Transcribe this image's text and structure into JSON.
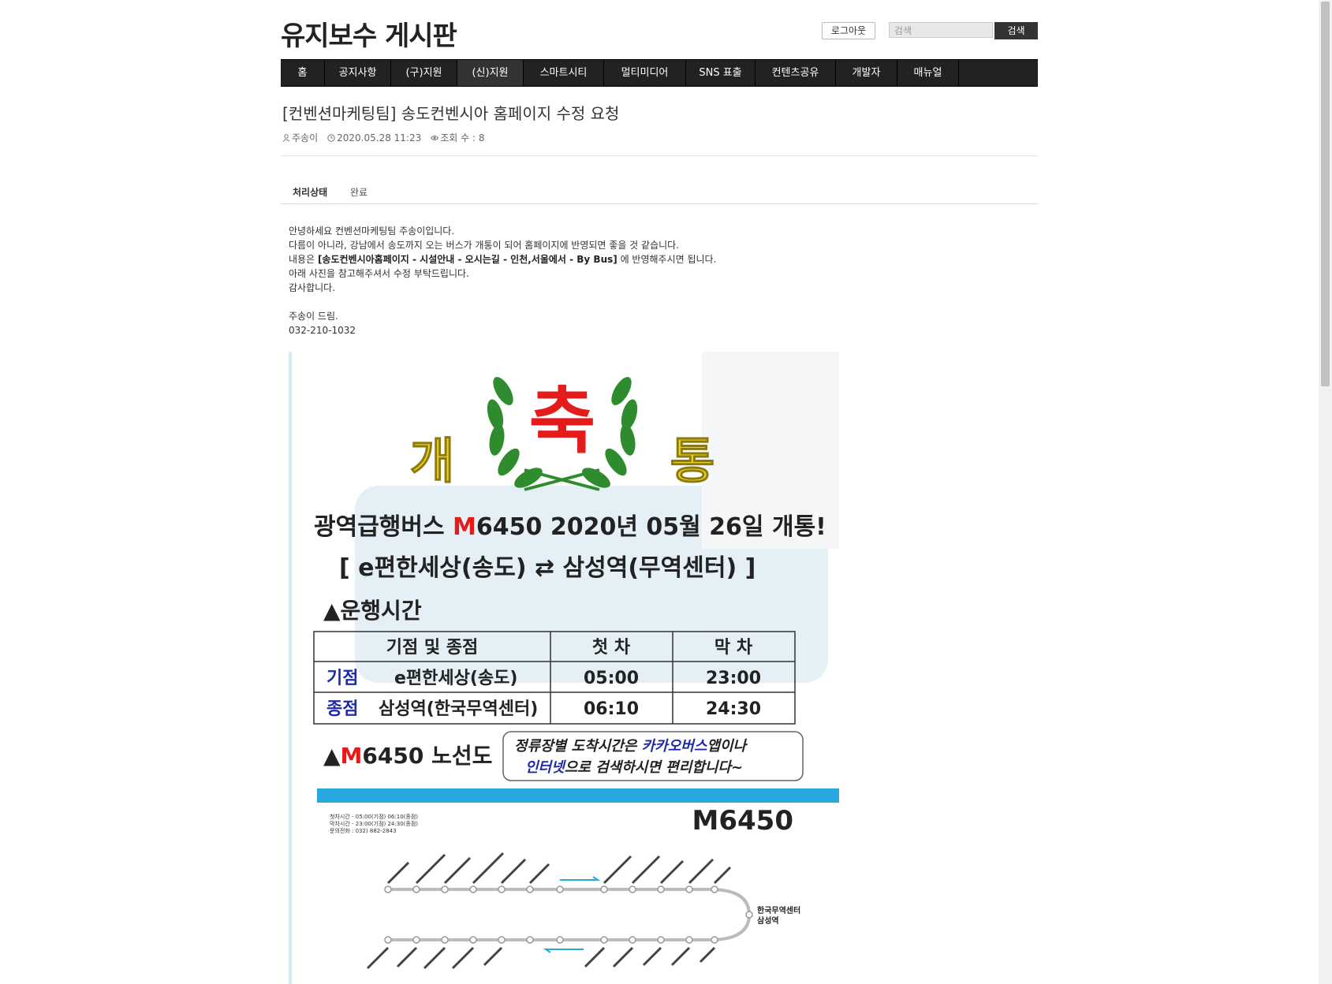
{
  "site": {
    "title": "유지보수 게시판"
  },
  "header": {
    "logout_label": "로그아웃",
    "search_placeholder": "검색",
    "search_button": "검색"
  },
  "nav": {
    "items": [
      {
        "label": "홈"
      },
      {
        "label": "공지사항"
      },
      {
        "label": "(구)지원"
      },
      {
        "label": "(신)지원"
      },
      {
        "label": "스마트시티"
      },
      {
        "label": "멀티미디어"
      },
      {
        "label": "SNS 표출"
      },
      {
        "label": "컨텐츠공유"
      },
      {
        "label": "개발자"
      },
      {
        "label": "매뉴얼"
      }
    ]
  },
  "post": {
    "title": "[컨벤션마케팅팀] 송도컨벤시아 홈페이지 수정 요청",
    "author": "주송이",
    "datetime": "2020.05.28 11:23",
    "views": "조회 수 : 8",
    "status_label": "처리상태",
    "status_value": "완료",
    "body": {
      "line1": "안녕하세요 컨벤션마케팅팀 주송이입니다.",
      "line2": "다름이 아니라, 강남에서 송도까지 오는 버스가 개통이 되어 홈페이지에 반영되면 좋을 것 같습니다.",
      "line3_pre": "내용은 ",
      "line3_bold": "[송도컨벤시아홈페이지 - 시설안내 - 오시는길 - 인천,서울에서 - By Bus]",
      "line3_post": " 에 반영해주시면 됩니다.",
      "line4": "아래 사진을 참고해주셔서 수정 부탁드립니다.",
      "line5": "감사합니다.",
      "line6": "주송이 드림.",
      "line7": "032-210-1032"
    }
  },
  "poster": {
    "left_char": "개",
    "center_char": "축",
    "right_char": "통",
    "headline_pre": "광역급행버스 ",
    "headline_m": "M",
    "headline_post": "6450 2020년 05월 26일 개통!",
    "route": "[ e편한세상(송도) ⇄ 삼성역(무역센터) ]",
    "section1": "▲운행시간",
    "table_header": [
      "기점 및 종점",
      "첫 차",
      "막 차"
    ],
    "table_rows": [
      {
        "tag": "기점",
        "place": "e편한세상(송도)",
        "first": "05:00",
        "last": "23:00"
      },
      {
        "tag": "종점",
        "place": "삼성역(한국무역센터)",
        "first": "06:10",
        "last": "24:30"
      }
    ],
    "section2_m": "M",
    "section2_post": "6450 노선도",
    "info_line1_pre": "정류장별 도착시간은 ",
    "info_line1_hl": "카카오버스",
    "info_line1_post": "앱이나",
    "info_line2_hl": "인터넷",
    "info_line2_post": "으로 검색하시면 편리합니다~",
    "map_title": "M6450",
    "map_info": [
      "첫차시간 - 05:00(기점) 06:10(종점)",
      "막차시간 - 23:00(기점) 24:30(종점)",
      "문의전화 : 032) 882-2843"
    ],
    "terminal_label_1": "한국무역센터",
    "terminal_label_2": "삼성역",
    "colors": {
      "red": "#e31b1b",
      "yellow": "#f2d21a",
      "green": "#2e8b2e",
      "blue": "#1e2aa8",
      "banner": "#29a8e0"
    }
  }
}
